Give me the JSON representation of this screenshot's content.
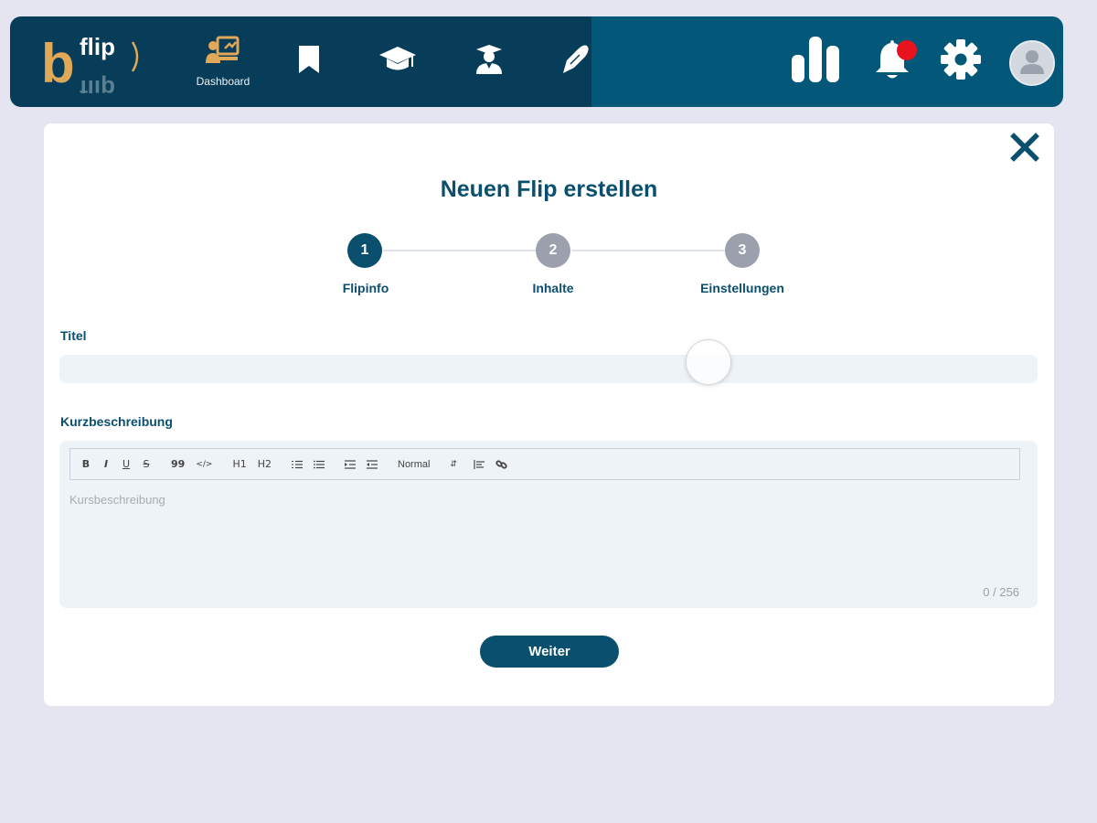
{
  "app": {
    "logo_top": "flip",
    "logo_mirror": "flip",
    "logo_initial": "b"
  },
  "nav": {
    "dashboard_label": "Dashboard",
    "bell_has_notification": true
  },
  "colors": {
    "brand_dark": "#073d58",
    "brand": "#0a4f6e",
    "brand_bar_right": "#03587a",
    "logo_orange": "#e0a95a",
    "notification_red": "#e8131e",
    "step_inactive": "#9ca0ad",
    "page_bg": "#e4e5f1"
  },
  "modal": {
    "title": "Neuen Flip erstellen",
    "steps": [
      {
        "number": "1",
        "label": "Flipinfo",
        "active": true
      },
      {
        "number": "2",
        "label": "Inhalte",
        "active": false
      },
      {
        "number": "3",
        "label": "Einstellungen",
        "active": false
      }
    ],
    "title_field": {
      "label": "Titel",
      "value": "",
      "placeholder": ""
    },
    "description": {
      "label": "Kurzbeschreibung",
      "placeholder": "Kursbeschreibung",
      "counter": "0 / 256",
      "toolbar": {
        "bold": "B",
        "italic": "I",
        "underline": "U",
        "strike": "S",
        "quote": "99",
        "code": "</>",
        "h1": "H1",
        "h2": "H2",
        "heading_select": "Normal"
      }
    },
    "next_button": "Weiter"
  },
  "icons": [
    "logo",
    "dashboard-icon",
    "bookmark-icon",
    "graduation-cap-icon",
    "teacher-icon",
    "pen-icon",
    "bar-chart-icon",
    "bell-icon",
    "gear-icon",
    "user-icon",
    "close-icon",
    "ordered-list-icon",
    "bullet-list-icon",
    "indent-icon",
    "outdent-icon",
    "align-icon",
    "link-icon"
  ]
}
